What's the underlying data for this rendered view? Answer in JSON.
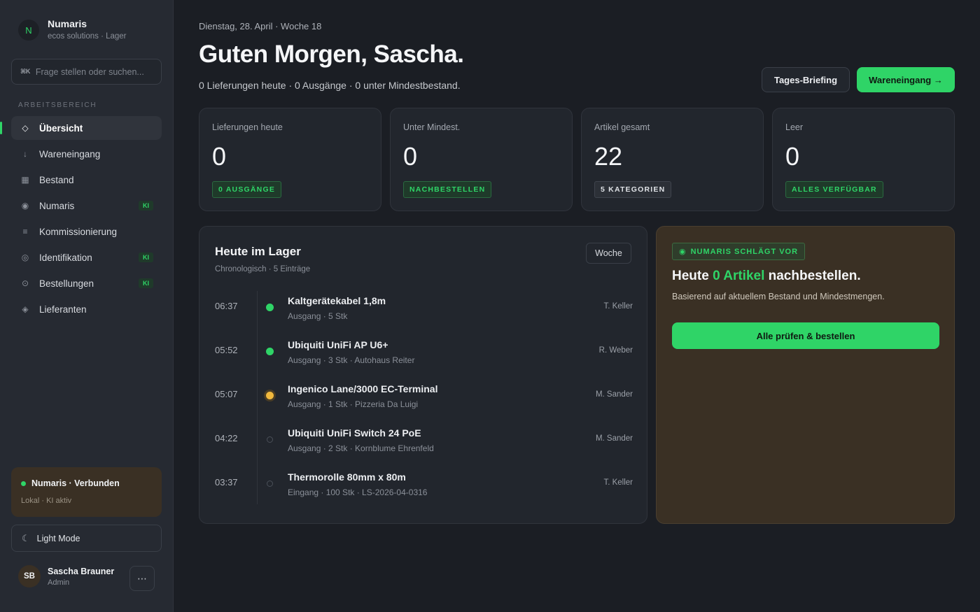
{
  "brand": {
    "logo_letter": "N",
    "name": "Numaris",
    "subtitle": "ecos solutions · Lager"
  },
  "search": {
    "shortcut": "⌘K",
    "placeholder": "Frage stellen oder suchen..."
  },
  "sidebar": {
    "section_label": "ARBEITSBEREICH",
    "items": [
      {
        "label": "Übersicht",
        "icon": "diamond-icon",
        "glyph": "◇",
        "active": true
      },
      {
        "label": "Wareneingang",
        "icon": "arrow-down-icon",
        "glyph": "↓"
      },
      {
        "label": "Bestand",
        "icon": "grid-icon",
        "glyph": "▦"
      },
      {
        "label": "Numaris",
        "icon": "target-icon",
        "glyph": "◉",
        "badge": "KI"
      },
      {
        "label": "Kommissionierung",
        "icon": "list-icon",
        "glyph": "≡"
      },
      {
        "label": "Identifikation",
        "icon": "scan-icon",
        "glyph": "◎",
        "badge": "KI"
      },
      {
        "label": "Bestellungen",
        "icon": "order-icon",
        "glyph": "⊙",
        "badge": "KI"
      },
      {
        "label": "Lieferanten",
        "icon": "supplier-icon",
        "glyph": "◈"
      }
    ]
  },
  "status": {
    "title": "Numaris · Verbunden",
    "subtitle": "Lokal · KI aktiv"
  },
  "theme": {
    "glyph": "☾",
    "label": "Light Mode"
  },
  "user": {
    "initials": "SB",
    "name": "Sascha Brauner",
    "role": "Admin",
    "more": "⋯"
  },
  "header": {
    "date": "Dienstag, 28. April · Woche 18",
    "greeting": "Guten Morgen, Sascha.",
    "summary": "0 Lieferungen heute · 0 Ausgänge · 0 unter Mindestbestand.",
    "briefing_label": "Tages-Briefing",
    "primary_label": "Wareneingang →"
  },
  "stats": [
    {
      "label": "Lieferungen heute",
      "value": "0",
      "tag": "0 AUSGÄNGE",
      "tag_style": "green"
    },
    {
      "label": "Unter Mindest.",
      "value": "0",
      "tag": "NACHBESTELLEN",
      "tag_style": "green"
    },
    {
      "label": "Artikel gesamt",
      "value": "22",
      "tag": "5 KATEGORIEN",
      "tag_style": "gray"
    },
    {
      "label": "Leer",
      "value": "0",
      "tag": "ALLES VERFÜGBAR",
      "tag_style": "green"
    }
  ],
  "today": {
    "title": "Heute im Lager",
    "subtitle": "Chronologisch · 5 Einträge",
    "week_label": "Woche",
    "events": [
      {
        "time": "06:37",
        "title": "Kaltgerätekabel 1,8m",
        "detail": "Ausgang · 5 Stk",
        "person": "T. Keller",
        "status": "green"
      },
      {
        "time": "05:52",
        "title": "Ubiquiti UniFi AP U6+",
        "detail": "Ausgang · 3 Stk · Autohaus Reiter",
        "person": "R. Weber",
        "status": "green"
      },
      {
        "time": "05:07",
        "title": "Ingenico Lane/3000 EC-Terminal",
        "detail": "Ausgang · 1 Stk · Pizzeria Da Luigi",
        "person": "M. Sander",
        "status": "orange"
      },
      {
        "time": "04:22",
        "title": "Ubiquiti UniFi Switch 24 PoE",
        "detail": "Ausgang · 2 Stk · Kornblume Ehrenfeld",
        "person": "M. Sander",
        "status": "empty"
      },
      {
        "time": "03:37",
        "title": "Thermorolle 80mm x 80m",
        "detail": "Eingang · 100 Stk · LS-2026-04-0316",
        "person": "T. Keller",
        "status": "empty"
      }
    ]
  },
  "suggestion": {
    "tag_glyph": "◉",
    "tag": "NUMARIS SCHLÄGT VOR",
    "title_pre": "Heute ",
    "title_highlight": "0 Artikel",
    "title_post": " nachbestellen.",
    "subtitle": "Basierend auf aktuellem Bestand und Mindestmengen.",
    "button_label": "Alle prüfen & bestellen"
  },
  "colors": {
    "accent": "#2fd467",
    "warning": "#f0b83d",
    "background": "#1b1e24",
    "sidebar": "#262a32",
    "suggestion_bg": "#3a3024"
  }
}
